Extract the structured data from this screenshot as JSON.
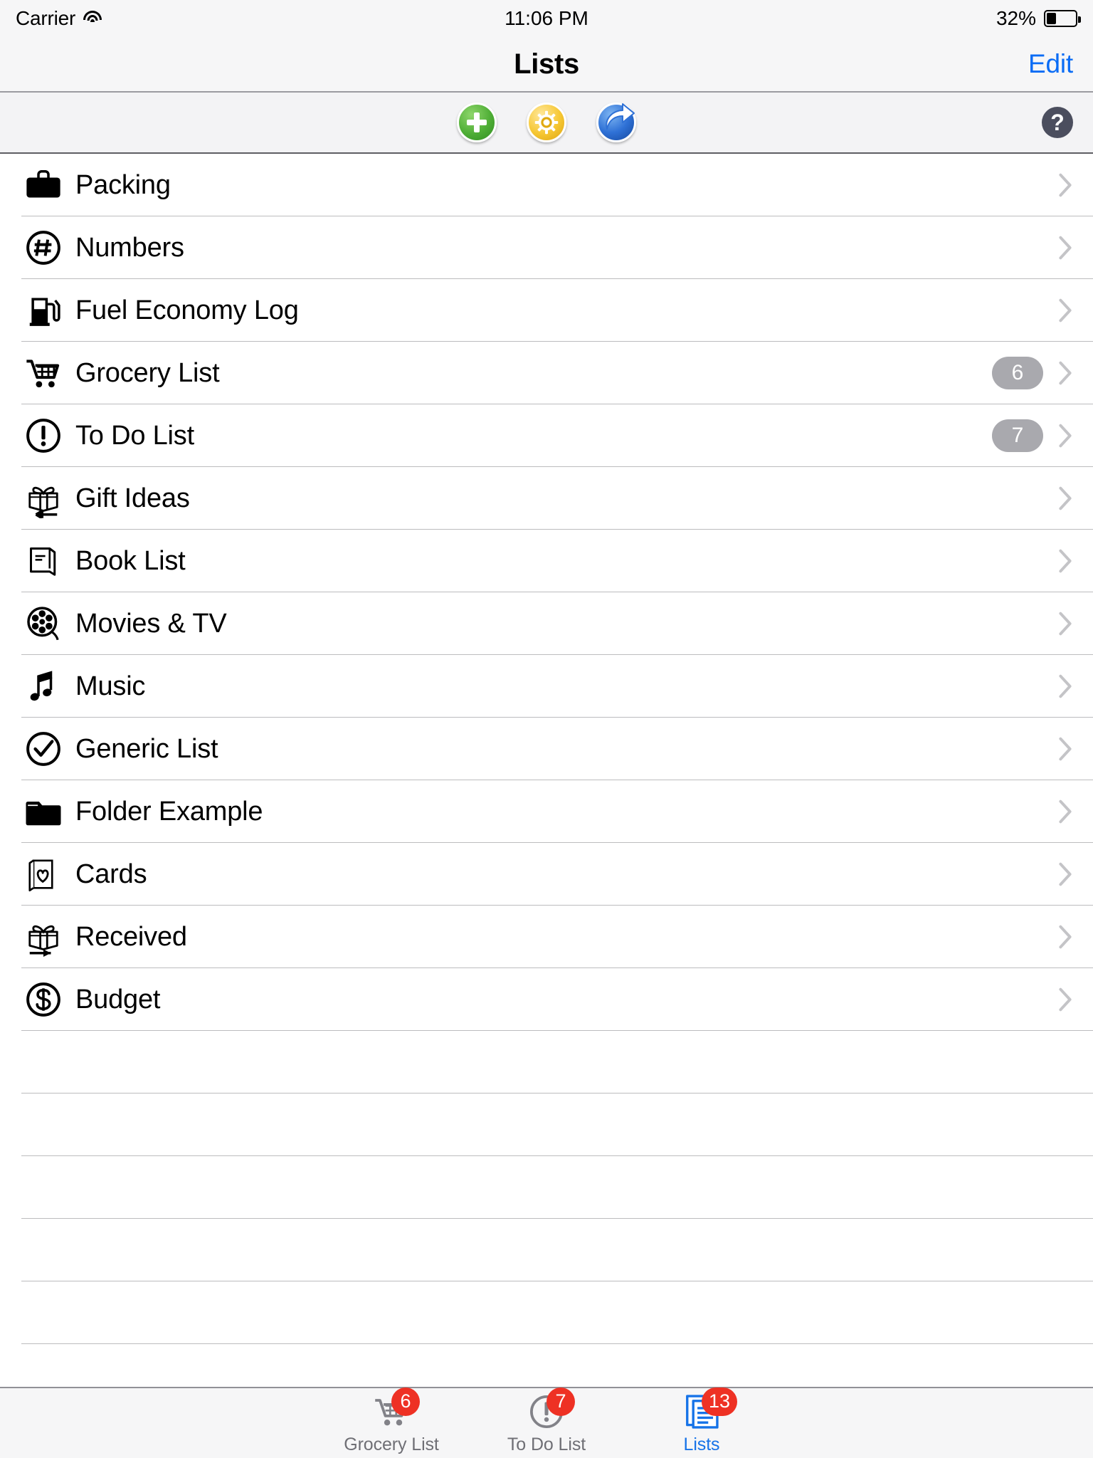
{
  "status_bar": {
    "carrier": "Carrier",
    "wifi_icon": "wifi-icon",
    "time": "11:06 PM",
    "battery_percent": "32%",
    "battery_level": 32
  },
  "nav_bar": {
    "title": "Lists",
    "edit_label": "Edit",
    "edit_color": "#0a6cf5"
  },
  "toolbar": {
    "buttons": [
      {
        "name": "add-list-button",
        "icon": "plus-circle-icon",
        "color": "#4fae36"
      },
      {
        "name": "settings-button",
        "icon": "gear-icon",
        "color": "#f6c733"
      },
      {
        "name": "share-button",
        "icon": "share-arrow-icon",
        "color": "#2f71d6"
      }
    ],
    "help_label": "?",
    "help_color": "#4b4e5e"
  },
  "list": {
    "rows": [
      {
        "label": "Packing",
        "icon": "briefcase-icon",
        "count": ""
      },
      {
        "label": "Numbers",
        "icon": "hash-circle-icon",
        "count": ""
      },
      {
        "label": "Fuel Economy Log",
        "icon": "fuel-pump-icon",
        "count": ""
      },
      {
        "label": "Grocery List",
        "icon": "shopping-cart-icon",
        "count": "6"
      },
      {
        "label": "To Do List",
        "icon": "exclamation-circle-icon",
        "count": "7"
      },
      {
        "label": "Gift Ideas",
        "icon": "gift-left-arrow-icon",
        "count": ""
      },
      {
        "label": "Book List",
        "icon": "book-icon",
        "count": ""
      },
      {
        "label": "Movies & TV",
        "icon": "film-reel-icon",
        "count": ""
      },
      {
        "label": "Music",
        "icon": "music-note-icon",
        "count": ""
      },
      {
        "label": "Generic List",
        "icon": "check-circle-icon",
        "count": ""
      },
      {
        "label": "Folder Example",
        "icon": "folder-icon",
        "count": ""
      },
      {
        "label": "Cards",
        "icon": "greeting-card-heart-icon",
        "count": ""
      },
      {
        "label": "Received",
        "icon": "gift-right-arrow-icon",
        "count": ""
      },
      {
        "label": "Budget",
        "icon": "dollar-circle-icon",
        "count": ""
      }
    ],
    "empty_row_count": 5,
    "badge_color": "#a9a9ae",
    "separator_color": "#bcbcbe"
  },
  "tab_bar": {
    "badge_color": "#ee3124",
    "selected_color": "#1673e8",
    "unselected_color": "#6f6f75",
    "tabs": [
      {
        "label": "Grocery List",
        "icon": "shopping-cart-icon",
        "badge": "6",
        "selected": false
      },
      {
        "label": "To Do List",
        "icon": "exclamation-circle-icon",
        "badge": "7",
        "selected": false
      },
      {
        "label": "Lists",
        "icon": "document-stack-icon",
        "badge": "13",
        "selected": true
      }
    ]
  }
}
